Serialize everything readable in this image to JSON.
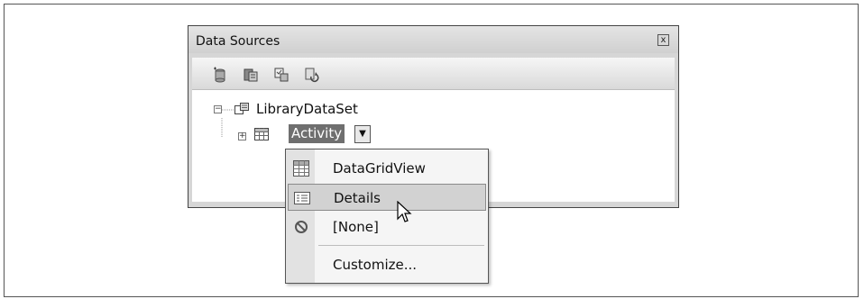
{
  "window": {
    "title": "Data Sources",
    "close_glyph": "x"
  },
  "toolbar": {
    "icons": [
      "add-new-data-source-icon",
      "edit-dataset-icon",
      "configure-dataset-icon",
      "refresh-icon"
    ]
  },
  "tree": {
    "root": {
      "label": "LibraryDataSet",
      "expander": "−",
      "icon": "dataset-icon"
    },
    "child": {
      "label": "Activity",
      "expander": "+",
      "icon": "table-icon",
      "dropdown_glyph": "▼"
    }
  },
  "menu": {
    "items": [
      {
        "label": "DataGridView",
        "icon": "datagridview-icon"
      },
      {
        "label": "Details",
        "icon": "details-icon",
        "highlighted": true
      },
      {
        "label": "[None]",
        "icon": "none-icon"
      },
      {
        "label": "Customize...",
        "icon": ""
      }
    ]
  }
}
